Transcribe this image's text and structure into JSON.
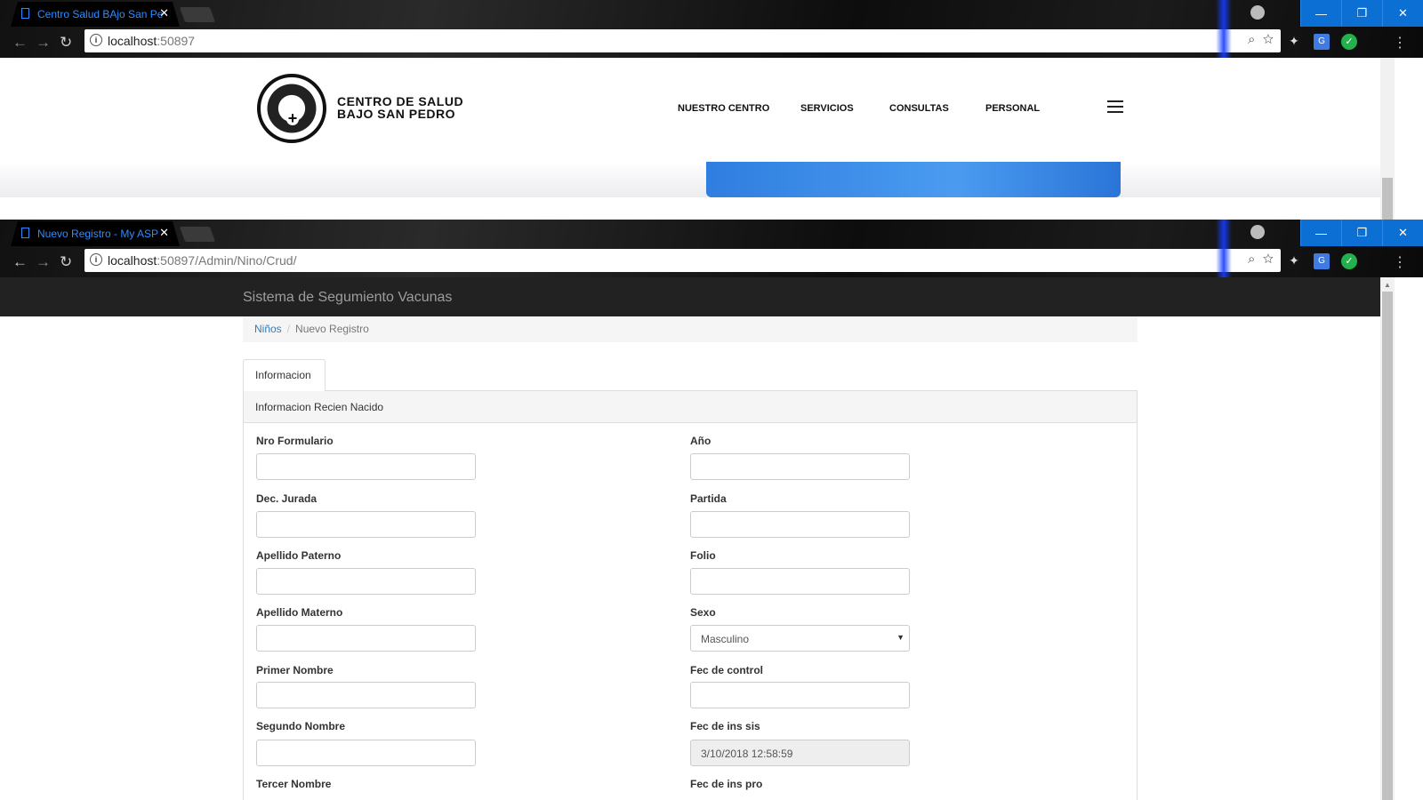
{
  "browser_top": {
    "tab_title": "Centro Salud BAjo San Pe",
    "url_host": "localhost",
    "url_rest": ":50897"
  },
  "site": {
    "name_line1": "CENTRO DE SALUD",
    "name_line2": "BAJO SAN PEDRO",
    "nav": [
      "NUESTRO CENTRO",
      "SERVICIOS",
      "CONSULTAS",
      "PERSONAL"
    ]
  },
  "browser_bottom": {
    "tab_title": "Nuevo Registro - My ASP",
    "url_host": "localhost",
    "url_rest": ":50897/Admin/Nino/Crud/"
  },
  "app": {
    "brand": "Sistema de Segumiento Vacunas",
    "breadcrumb": {
      "parent": "Niños",
      "current": "Nuevo Registro"
    },
    "tab": "Informacion",
    "panel_title": "Informacion Recien Nacido",
    "left_fields": [
      {
        "label": "Nro Formulario",
        "value": ""
      },
      {
        "label": "Dec. Jurada",
        "value": ""
      },
      {
        "label": "Apellido Paterno",
        "value": ""
      },
      {
        "label": "Apellido Materno",
        "value": ""
      },
      {
        "label": "Primer Nombre",
        "value": ""
      },
      {
        "label": "Segundo Nombre",
        "value": ""
      },
      {
        "label": "Tercer Nombre",
        "value": ""
      }
    ],
    "right_fields": [
      {
        "label": "Año",
        "value": ""
      },
      {
        "label": "Partida",
        "value": ""
      },
      {
        "label": "Folio",
        "value": ""
      },
      {
        "label": "Sexo",
        "value": "Masculino"
      },
      {
        "label": "Fec de control",
        "value": ""
      },
      {
        "label": "Fec de ins sis",
        "value": "3/10/2018 12:58:59"
      },
      {
        "label": "Fec de ins pro",
        "value": ""
      }
    ]
  },
  "colors": {
    "accent_blue": "#0c6fd4",
    "link": "#337ab7",
    "navbar": "#222222"
  }
}
